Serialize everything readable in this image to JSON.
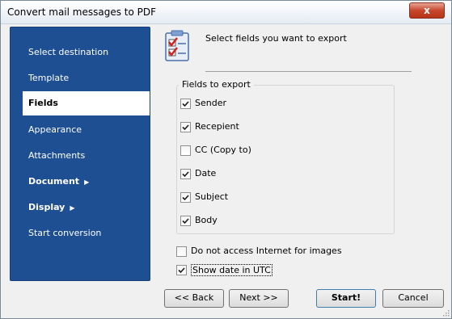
{
  "window": {
    "title": "Convert mail messages to PDF",
    "close_glyph": "x"
  },
  "sidebar": {
    "items": [
      {
        "label": "Select destination",
        "bold": false,
        "arrow": false,
        "active": false
      },
      {
        "label": "Template",
        "bold": false,
        "arrow": false,
        "active": false
      },
      {
        "label": "Fields",
        "bold": true,
        "arrow": false,
        "active": true
      },
      {
        "label": "Appearance",
        "bold": false,
        "arrow": false,
        "active": false
      },
      {
        "label": "Attachments",
        "bold": false,
        "arrow": false,
        "active": false
      },
      {
        "label": "Document",
        "bold": true,
        "arrow": true,
        "active": false
      },
      {
        "label": "Display",
        "bold": true,
        "arrow": true,
        "active": false
      },
      {
        "label": "Start conversion",
        "bold": false,
        "arrow": false,
        "active": false
      }
    ],
    "arrow_glyph": "▶"
  },
  "header": {
    "icon": "checklist-icon",
    "text": "Select fields you want to export"
  },
  "fields": {
    "title": "Fields to export",
    "items": [
      {
        "label": "Sender",
        "checked": true
      },
      {
        "label": "Recepient",
        "checked": true
      },
      {
        "label": "CC (Copy to)",
        "checked": false
      },
      {
        "label": "Date",
        "checked": true
      },
      {
        "label": "Subject",
        "checked": true
      },
      {
        "label": "Body",
        "checked": true
      }
    ]
  },
  "options": [
    {
      "label": "Do not access Internet for images",
      "checked": false
    },
    {
      "label": "Show date in UTC",
      "checked": true
    }
  ],
  "buttons": {
    "back": "<< Back",
    "next": "Next >>",
    "start": "Start!",
    "cancel": "Cancel"
  },
  "colors": {
    "sidebar": "#1e4f93",
    "accent_check": "#1a1a1a"
  }
}
